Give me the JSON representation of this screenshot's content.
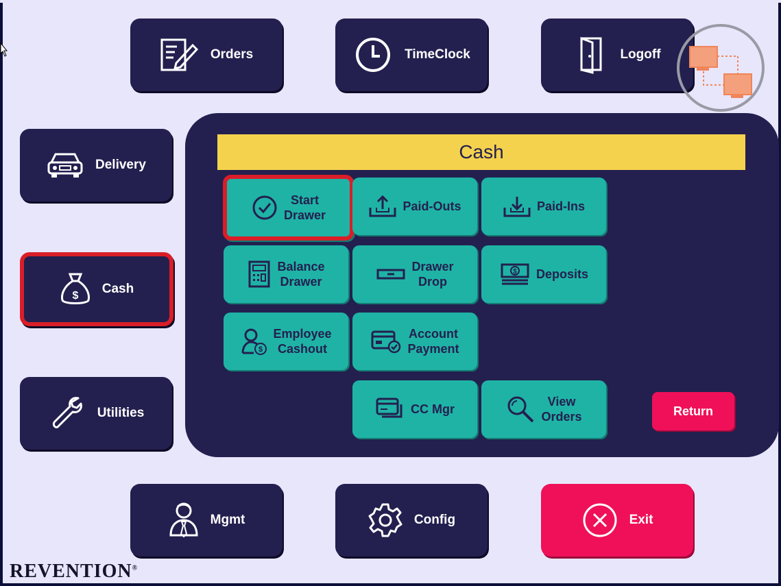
{
  "top_nav": {
    "orders": "Orders",
    "timeclock": "TimeClock",
    "logoff": "Logoff"
  },
  "side_nav": {
    "delivery": "Delivery",
    "cash": "Cash",
    "utilities": "Utilities"
  },
  "bottom_nav": {
    "mgmt": "Mgmt",
    "config": "Config",
    "exit": "Exit"
  },
  "cash_panel": {
    "title": "Cash",
    "tiles": {
      "start_drawer_l1": "Start",
      "start_drawer_l2": "Drawer",
      "paid_outs": "Paid-Outs",
      "paid_ins": "Paid-Ins",
      "balance_drawer_l1": "Balance",
      "balance_drawer_l2": "Drawer",
      "drawer_drop_l1": "Drawer",
      "drawer_drop_l2": "Drop",
      "deposits": "Deposits",
      "employee_cashout_l1": "Employee",
      "employee_cashout_l2": "Cashout",
      "account_payment_l1": "Account",
      "account_payment_l2": "Payment",
      "cc_mgr": "CC Mgr",
      "view_orders_l1": "View",
      "view_orders_l2": "Orders"
    },
    "return": "Return"
  },
  "brand": {
    "logo_text": "REVENTION",
    "reg": "®"
  },
  "colors": {
    "background": "#e8e6fb",
    "nav_button": "#23204f",
    "tile": "#1fb3a6",
    "title_bar": "#f5d24e",
    "accent_red": "#f0105a",
    "highlight": "#d91e28"
  },
  "icons": [
    "pencil-paper-icon",
    "clock-icon",
    "door-icon",
    "network-status-icon",
    "car-icon",
    "money-bag-icon",
    "wrench-icon",
    "person-tie-icon",
    "gear-icon",
    "close-circle-icon",
    "check-circle-icon",
    "tray-up-icon",
    "tray-down-icon",
    "calculator-icon",
    "drawer-icon",
    "banknote-icon",
    "employee-money-icon",
    "card-check-icon",
    "cards-icon",
    "magnifier-icon"
  ]
}
